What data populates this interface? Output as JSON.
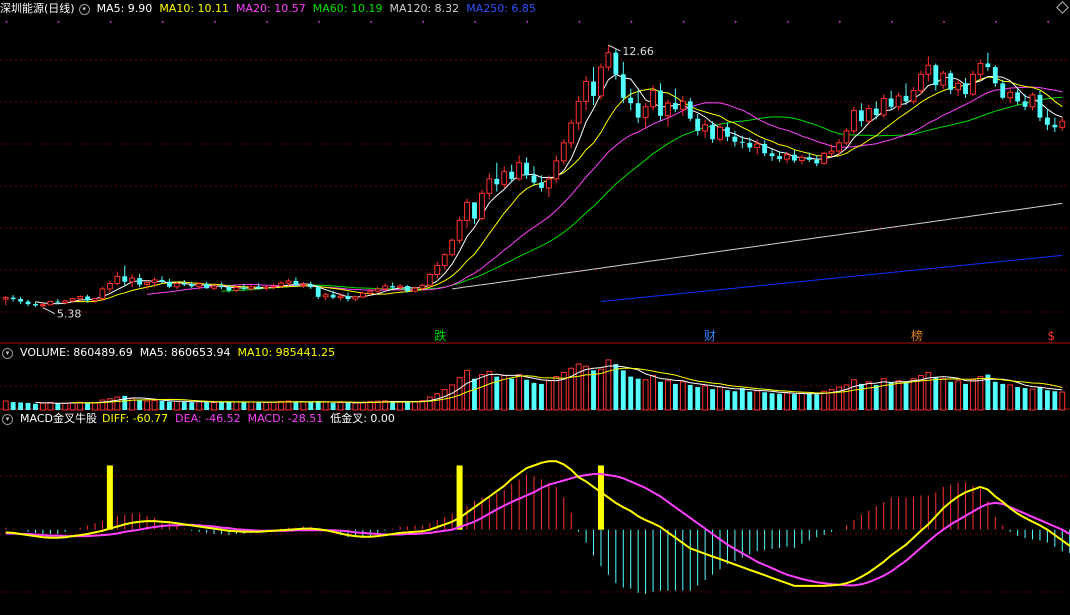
{
  "header_price": {
    "title": "深圳能源(日线)",
    "ma5": "MA5: 9.90",
    "ma10": "MA10: 10.11",
    "ma20": "MA20: 10.57",
    "ma60": "MA60: 10.19",
    "ma120": "MA120: 8.32",
    "ma250": "MA250: 6.85"
  },
  "header_volume": {
    "volume": "VOLUME: 860489.69",
    "ma5": "MA5: 860653.94",
    "ma10": "MA10: 985441.25"
  },
  "header_macd": {
    "name": "MACD金叉牛股",
    "diff": "DIFF: -60.77",
    "dea": "DEA: -46.52",
    "macd": "MACD: -28.51",
    "golden": "低金叉: 0.00"
  },
  "colors": {
    "up": "#ff3030",
    "down": "#54ffff",
    "ma5": "#ffffff",
    "ma10": "#ffff00",
    "ma20": "#ff40ff",
    "ma60": "#00e000",
    "ma120": "#d0d0d0",
    "ma250": "#1030ff",
    "diff": "#ffff00",
    "dea": "#ff40ff"
  },
  "chart_data": {
    "type": "candlestick",
    "price_ylim": [
      4.9,
      13.3
    ],
    "price_marks": {
      "high": "12.66",
      "high_index": 81,
      "low": "5.38",
      "low_index": 5
    },
    "candles_ohlc": [
      [
        5.62,
        5.71,
        5.45,
        5.66
      ],
      [
        5.66,
        5.73,
        5.55,
        5.62
      ],
      [
        5.62,
        5.68,
        5.48,
        5.55
      ],
      [
        5.55,
        5.6,
        5.42,
        5.48
      ],
      [
        5.48,
        5.54,
        5.4,
        5.44
      ],
      [
        5.44,
        5.5,
        5.38,
        5.46
      ],
      [
        5.46,
        5.58,
        5.44,
        5.55
      ],
      [
        5.55,
        5.62,
        5.48,
        5.52
      ],
      [
        5.52,
        5.6,
        5.47,
        5.57
      ],
      [
        5.57,
        5.66,
        5.52,
        5.63
      ],
      [
        5.63,
        5.72,
        5.58,
        5.69
      ],
      [
        5.69,
        5.74,
        5.52,
        5.58
      ],
      [
        5.58,
        5.66,
        5.51,
        5.63
      ],
      [
        5.63,
        5.96,
        5.6,
        5.9
      ],
      [
        5.9,
        6.12,
        5.8,
        6.05
      ],
      [
        6.05,
        6.38,
        6.0,
        6.25
      ],
      [
        6.25,
        6.55,
        6.0,
        6.1
      ],
      [
        6.1,
        6.3,
        5.95,
        6.2
      ],
      [
        6.2,
        6.32,
        5.95,
        6.02
      ],
      [
        6.02,
        6.14,
        5.88,
        6.08
      ],
      [
        6.08,
        6.22,
        5.96,
        6.15
      ],
      [
        6.15,
        6.25,
        6.05,
        6.1
      ],
      [
        6.1,
        6.18,
        5.92,
        5.96
      ],
      [
        5.96,
        6.1,
        5.9,
        6.05
      ],
      [
        6.05,
        6.15,
        5.98,
        6.02
      ],
      [
        6.02,
        6.1,
        5.92,
        5.97
      ],
      [
        5.97,
        6.08,
        5.88,
        6.04
      ],
      [
        6.04,
        6.1,
        5.9,
        5.92
      ],
      [
        5.92,
        6.02,
        5.86,
        5.98
      ],
      [
        5.98,
        6.08,
        5.9,
        5.95
      ],
      [
        5.95,
        6.02,
        5.8,
        5.86
      ],
      [
        5.86,
        5.98,
        5.8,
        5.94
      ],
      [
        5.94,
        6.04,
        5.85,
        5.9
      ],
      [
        5.9,
        6.02,
        5.84,
        5.96
      ],
      [
        5.96,
        6.05,
        5.88,
        5.92
      ],
      [
        5.92,
        6.0,
        5.85,
        5.95
      ],
      [
        5.95,
        6.05,
        5.88,
        5.98
      ],
      [
        5.98,
        6.12,
        5.92,
        6.06
      ],
      [
        6.06,
        6.18,
        5.98,
        6.12
      ],
      [
        6.12,
        6.22,
        5.96,
        6.0
      ],
      [
        6.0,
        6.1,
        5.92,
        6.02
      ],
      [
        6.02,
        6.1,
        5.9,
        5.95
      ],
      [
        5.95,
        6.0,
        5.62,
        5.68
      ],
      [
        5.68,
        5.8,
        5.58,
        5.74
      ],
      [
        5.74,
        5.85,
        5.62,
        5.66
      ],
      [
        5.66,
        5.78,
        5.58,
        5.7
      ],
      [
        5.7,
        5.8,
        5.55,
        5.62
      ],
      [
        5.62,
        5.72,
        5.56,
        5.68
      ],
      [
        5.68,
        5.82,
        5.64,
        5.78
      ],
      [
        5.78,
        5.9,
        5.72,
        5.84
      ],
      [
        5.84,
        5.96,
        5.78,
        5.9
      ],
      [
        5.9,
        6.05,
        5.84,
        5.98
      ],
      [
        5.98,
        6.08,
        5.9,
        5.94
      ],
      [
        5.94,
        6.04,
        5.85,
        5.98
      ],
      [
        5.98,
        6.0,
        5.8,
        5.84
      ],
      [
        5.84,
        5.95,
        5.8,
        5.92
      ],
      [
        5.92,
        6.05,
        5.85,
        6.0
      ],
      [
        6.0,
        6.35,
        5.96,
        6.3
      ],
      [
        6.3,
        6.65,
        6.2,
        6.55
      ],
      [
        6.55,
        6.9,
        6.45,
        6.85
      ],
      [
        6.85,
        7.3,
        6.8,
        7.25
      ],
      [
        7.25,
        7.9,
        7.15,
        7.8
      ],
      [
        7.8,
        8.4,
        7.6,
        8.3
      ],
      [
        8.3,
        8.25,
        7.7,
        7.85
      ],
      [
        7.85,
        8.65,
        7.8,
        8.55
      ],
      [
        8.55,
        9.1,
        8.4,
        8.95
      ],
      [
        8.95,
        9.4,
        8.6,
        8.8
      ],
      [
        8.8,
        9.3,
        8.7,
        9.15
      ],
      [
        9.15,
        9.35,
        8.85,
        8.95
      ],
      [
        8.95,
        9.6,
        8.9,
        9.4
      ],
      [
        9.4,
        9.55,
        8.95,
        9.05
      ],
      [
        9.05,
        9.3,
        8.75,
        8.85
      ],
      [
        8.85,
        9.05,
        8.6,
        8.7
      ],
      [
        8.7,
        9.05,
        8.45,
        8.95
      ],
      [
        8.95,
        9.6,
        8.85,
        9.45
      ],
      [
        9.45,
        10.05,
        9.35,
        9.95
      ],
      [
        9.95,
        10.6,
        9.8,
        10.5
      ],
      [
        10.5,
        11.25,
        10.3,
        11.1
      ],
      [
        11.1,
        11.8,
        10.85,
        11.65
      ],
      [
        11.65,
        12.05,
        11.0,
        11.25
      ],
      [
        11.25,
        12.15,
        11.15,
        12.05
      ],
      [
        12.05,
        12.66,
        11.95,
        12.45
      ],
      [
        12.45,
        12.55,
        11.7,
        11.85
      ],
      [
        11.85,
        12.2,
        11.05,
        11.2
      ],
      [
        11.2,
        11.45,
        10.85,
        11.05
      ],
      [
        11.05,
        11.4,
        10.5,
        10.65
      ],
      [
        10.65,
        11.05,
        10.35,
        10.95
      ],
      [
        10.95,
        11.55,
        10.85,
        11.4
      ],
      [
        11.4,
        11.6,
        10.55,
        10.7
      ],
      [
        10.7,
        11.15,
        10.4,
        11.05
      ],
      [
        11.05,
        11.45,
        10.8,
        10.88
      ],
      [
        10.88,
        11.25,
        10.7,
        11.1
      ],
      [
        11.1,
        11.2,
        10.55,
        10.62
      ],
      [
        10.62,
        10.75,
        10.15,
        10.28
      ],
      [
        10.28,
        10.6,
        10.1,
        10.45
      ],
      [
        10.45,
        10.55,
        9.95,
        10.05
      ],
      [
        10.05,
        10.5,
        9.98,
        10.38
      ],
      [
        10.38,
        10.52,
        10.0,
        10.12
      ],
      [
        10.12,
        10.28,
        9.85,
        9.98
      ],
      [
        9.98,
        10.15,
        9.8,
        9.95
      ],
      [
        9.95,
        10.1,
        9.7,
        9.82
      ],
      [
        9.82,
        10.05,
        9.62,
        9.92
      ],
      [
        9.92,
        10.02,
        9.58,
        9.66
      ],
      [
        9.66,
        9.78,
        9.45,
        9.58
      ],
      [
        9.58,
        9.72,
        9.42,
        9.5
      ],
      [
        9.5,
        9.7,
        9.38,
        9.62
      ],
      [
        9.62,
        9.75,
        9.4,
        9.46
      ],
      [
        9.46,
        9.62,
        9.35,
        9.55
      ],
      [
        9.55,
        9.68,
        9.42,
        9.48
      ],
      [
        9.48,
        9.6,
        9.3,
        9.38
      ],
      [
        9.38,
        9.7,
        9.35,
        9.66
      ],
      [
        9.66,
        9.9,
        9.58,
        9.72
      ],
      [
        9.72,
        10.05,
        9.62,
        9.95
      ],
      [
        9.95,
        10.35,
        9.9,
        10.28
      ],
      [
        10.28,
        10.95,
        10.2,
        10.85
      ],
      [
        10.85,
        11.05,
        10.4,
        10.55
      ],
      [
        10.55,
        11.0,
        10.45,
        10.9
      ],
      [
        10.9,
        11.1,
        10.6,
        10.72
      ],
      [
        10.72,
        11.3,
        10.65,
        11.18
      ],
      [
        11.18,
        11.4,
        10.85,
        10.95
      ],
      [
        10.95,
        11.35,
        10.85,
        11.25
      ],
      [
        11.25,
        11.6,
        11.0,
        11.1
      ],
      [
        11.1,
        11.5,
        11.02,
        11.4
      ],
      [
        11.4,
        11.95,
        11.3,
        11.85
      ],
      [
        11.85,
        12.35,
        11.65,
        12.1
      ],
      [
        12.1,
        12.15,
        11.4,
        11.55
      ],
      [
        11.55,
        11.95,
        11.45,
        11.88
      ],
      [
        11.88,
        11.95,
        11.3,
        11.42
      ],
      [
        11.42,
        11.7,
        11.25,
        11.6
      ],
      [
        11.6,
        11.75,
        11.2,
        11.3
      ],
      [
        11.3,
        11.95,
        11.25,
        11.85
      ],
      [
        11.85,
        12.25,
        11.7,
        12.15
      ],
      [
        12.15,
        12.45,
        11.95,
        12.05
      ],
      [
        12.05,
        12.1,
        11.5,
        11.6
      ],
      [
        11.6,
        11.7,
        11.15,
        11.2
      ],
      [
        11.2,
        11.45,
        11.05,
        11.35
      ],
      [
        11.35,
        11.45,
        11.0,
        11.1
      ],
      [
        11.1,
        11.3,
        10.85,
        10.95
      ],
      [
        10.95,
        11.35,
        10.85,
        11.28
      ],
      [
        11.28,
        11.4,
        10.55,
        10.65
      ],
      [
        10.65,
        10.9,
        10.3,
        10.45
      ],
      [
        10.45,
        10.65,
        10.25,
        10.38
      ],
      [
        10.38,
        10.65,
        10.28,
        10.55
      ]
    ],
    "volume": [
      430000,
      380000,
      360000,
      340000,
      300000,
      330000,
      360000,
      310000,
      330000,
      350000,
      370000,
      360000,
      340000,
      480000,
      540000,
      620000,
      680000,
      560000,
      500000,
      420000,
      450000,
      430000,
      400000,
      420000,
      390000,
      370000,
      410000,
      380000,
      360000,
      390000,
      400000,
      380000,
      360000,
      390000,
      370000,
      360000,
      380000,
      410000,
      430000,
      400000,
      380000,
      370000,
      420000,
      380000,
      340000,
      360000,
      350000,
      330000,
      370000,
      400000,
      420000,
      440000,
      400000,
      380000,
      390000,
      410000,
      450000,
      620000,
      780000,
      980000,
      1200000,
      1550000,
      1900000,
      1500000,
      1700000,
      1850000,
      1600000,
      1650000,
      1500000,
      1700000,
      1450000,
      1300000,
      1250000,
      1400000,
      1600000,
      1800000,
      2000000,
      2200000,
      2100000,
      1900000,
      1950000,
      2400000,
      2200000,
      1900000,
      1600000,
      1500000,
      1450000,
      1650000,
      1350000,
      1400000,
      1250000,
      1350000,
      1200000,
      1100000,
      1150000,
      1000000,
      1100000,
      950000,
      900000,
      1050000,
      880000,
      920000,
      850000,
      800000,
      780000,
      820000,
      760000,
      800000,
      770000,
      750000,
      900000,
      980000,
      1100000,
      1200000,
      1450000,
      1250000,
      1350000,
      1200000,
      1500000,
      1300000,
      1400000,
      1350000,
      1500000,
      1650000,
      1800000,
      1550000,
      1500000,
      1350000,
      1400000,
      1250000,
      1450000,
      1600000,
      1700000,
      1350000,
      1250000,
      1200000,
      1100000,
      1050000,
      1000000,
      1100000,
      950000,
      900000,
      860489
    ],
    "volume_ylim": [
      0,
      2300000
    ],
    "macd_ylim": [
      -150,
      190
    ],
    "diff": [
      -5,
      -6,
      -8,
      -10,
      -12,
      -14,
      -15,
      -15,
      -14,
      -12,
      -10,
      -8,
      -5,
      -2,
      2,
      6,
      10,
      13,
      15,
      16,
      16,
      15,
      14,
      12,
      10,
      8,
      6,
      4,
      2,
      0,
      -2,
      -3,
      -4,
      -4,
      -4,
      -3,
      -2,
      -1,
      0,
      1,
      2,
      2,
      1,
      -1,
      -4,
      -7,
      -10,
      -12,
      -13,
      -13,
      -12,
      -10,
      -8,
      -6,
      -5,
      -4,
      -3,
      0,
      5,
      10,
      15,
      22,
      32,
      42,
      52,
      62,
      72,
      82,
      95,
      105,
      115,
      120,
      125,
      128,
      128,
      122,
      112,
      98,
      90,
      80,
      70,
      60,
      50,
      42,
      35,
      25,
      18,
      12,
      5,
      -5,
      -15,
      -25,
      -35,
      -40,
      -45,
      -50,
      -55,
      -60,
      -65,
      -70,
      -75,
      -80,
      -85,
      -90,
      -95,
      -100,
      -105,
      -105,
      -105,
      -105,
      -105,
      -104,
      -103,
      -100,
      -95,
      -88,
      -80,
      -70,
      -60,
      -48,
      -38,
      -28,
      -15,
      -2,
      10,
      25,
      40,
      52,
      62,
      70,
      75,
      80,
      75,
      62,
      52,
      40,
      30,
      22,
      15,
      8,
      0,
      -10,
      -20,
      -30,
      -40,
      -50,
      -58,
      -62,
      -60.77
    ],
    "dea": [
      -7,
      -7,
      -8,
      -8,
      -9,
      -10,
      -11,
      -11,
      -12,
      -12,
      -12,
      -12,
      -11,
      -10,
      -9,
      -7,
      -4,
      -2,
      0,
      3,
      5,
      7,
      8,
      8,
      9,
      9,
      8,
      7,
      6,
      4,
      3,
      1,
      0,
      -1,
      -2,
      -2,
      -2,
      -2,
      -2,
      -1,
      -1,
      -1,
      -1,
      -1,
      -1,
      -2,
      -3,
      -5,
      -6,
      -7,
      -8,
      -9,
      -9,
      -9,
      -8,
      -8,
      -7,
      -6,
      -4,
      -2,
      0,
      5,
      10,
      15,
      22,
      30,
      38,
      45,
      52,
      58,
      64,
      70,
      78,
      84,
      88,
      92,
      96,
      100,
      102,
      104,
      104,
      102,
      100,
      96,
      90,
      84,
      78,
      70,
      62,
      52,
      42,
      32,
      22,
      12,
      2,
      -8,
      -18,
      -28,
      -36,
      -44,
      -52,
      -60,
      -66,
      -72,
      -78,
      -84,
      -88,
      -92,
      -95,
      -98,
      -100,
      -102,
      -103,
      -104,
      -104,
      -102,
      -98,
      -92,
      -86,
      -78,
      -68,
      -58,
      -46,
      -34,
      -22,
      -10,
      0,
      10,
      18,
      26,
      34,
      42,
      48,
      50,
      48,
      42,
      36,
      30,
      24,
      18,
      12,
      6,
      0,
      -8,
      -16,
      -24,
      -32,
      -40,
      -46.52
    ],
    "golden_cross_markers": [
      14,
      61,
      80,
      152
    ],
    "signal_labels": [
      {
        "text": "跌",
        "index": 117,
        "color": "#00e000"
      },
      {
        "text": "财",
        "index": 190,
        "color": "#3080ff"
      },
      {
        "text": "榜",
        "index": 246,
        "color": "#e08020"
      },
      {
        "text": "$",
        "index": 283,
        "color": "#ff3030"
      }
    ]
  }
}
